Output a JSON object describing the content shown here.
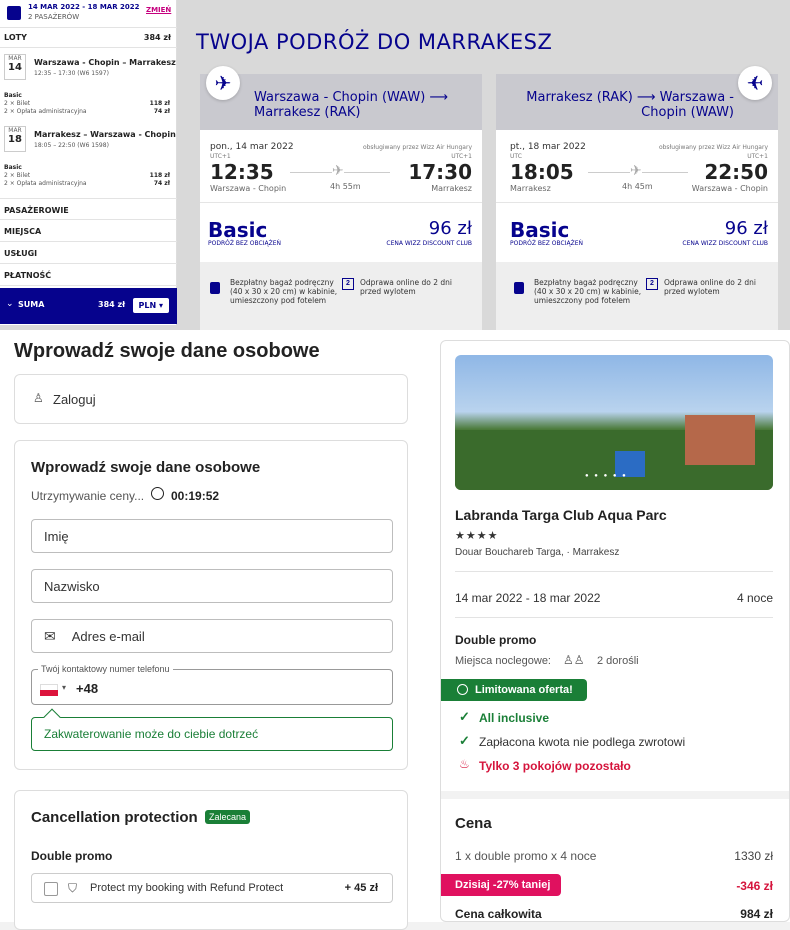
{
  "summary": {
    "dates": "14 MAR 2022 - 18 MAR 2022",
    "passengers": "2 PASAŻERÓW",
    "change": "ZMIEŃ",
    "flights_label": "LOTY",
    "flights_total": "384 zł",
    "flight1": {
      "month": "MAR",
      "day": "14",
      "route": "Warszawa - Chopin – Marrakesz",
      "time": "12:35 – 17:30 (W6 1597)",
      "fare": "Basic",
      "line1": "2 × Bilet",
      "line1_price": "118 zł",
      "line2": "2 × Opłata administracyjna",
      "line2_price": "74 zł"
    },
    "flight2": {
      "month": "MAR",
      "day": "18",
      "route": "Marrakesz – Warszawa - Chopin",
      "time": "18:05 – 22:50 (W6 1598)",
      "fare": "Basic",
      "line1": "2 × Bilet",
      "line1_price": "118 zł",
      "line2": "2 × Opłata administracyjna",
      "line2_price": "74 zł"
    },
    "sections": [
      "PASAŻEROWIE",
      "MIEJSCA",
      "USŁUGI",
      "PŁATNOŚĆ"
    ],
    "suma_label": "SUMA",
    "suma_value": "384 zł",
    "currency": "PLN"
  },
  "trip_title": "TWOJA PODRÓŻ DO MARRAKESZ",
  "outbound": {
    "title": "Warszawa - Chopin (WAW) ⟶ Marrakesz (RAK)",
    "date": "pon., 14 mar 2022",
    "operated": "obsługiwany przez Wizz Air Hungary",
    "utc_dep": "UTC+1",
    "utc_arr": "UTC+1",
    "dep_time": "12:35",
    "arr_time": "17:30",
    "duration": "4h 55m",
    "dep_city": "Warszawa - Chopin",
    "arr_city": "Marrakesz",
    "fare": "Basic",
    "fare_sub": "PODRÓŻ BEZ OBCIĄŻEŃ",
    "price": "96 zł",
    "price_sub": "CENA WIZZ DISCOUNT CLUB",
    "bag": "Bezpłatny bagaż podręczny (40 x 30 x 20 cm) w kabinie, umieszczony pod fotelem",
    "checkin_num": "2",
    "checkin": "Odprawa online do 2 dni przed wylotem"
  },
  "inbound": {
    "title": "Marrakesz (RAK) ⟶ Warszawa - Chopin (WAW)",
    "date": "pt., 18 mar 2022",
    "operated": "obsługiwany przez Wizz Air Hungary",
    "utc_dep": "UTC",
    "utc_arr": "UTC+1",
    "dep_time": "18:05",
    "arr_time": "22:50",
    "duration": "4h 45m",
    "dep_city": "Marrakesz",
    "arr_city": "Warszawa - Chopin",
    "fare": "Basic",
    "fare_sub": "PODRÓŻ BEZ OBCIĄŻEŃ",
    "price": "96 zł",
    "price_sub": "CENA WIZZ DISCOUNT CLUB",
    "bag": "Bezpłatny bagaż podręczny (40 x 30 x 20 cm) w kabinie, umieszczony pod fotelem",
    "checkin_num": "2",
    "checkin": "Odprawa online do 2 dni przed wylotem"
  },
  "form": {
    "heading": "Wprowadź swoje dane osobowe",
    "login": "Zaloguj",
    "subheading": "Wprowadź swoje dane osobowe",
    "hold_label": "Utrzymywanie ceny...",
    "timer": "00:19:52",
    "first_name_placeholder": "Imię",
    "last_name_placeholder": "Nazwisko",
    "email_placeholder": "Adres e-mail",
    "phone_label": "Twój kontaktowy numer telefonu",
    "phone_prefix": "+48",
    "tooltip": "Zakwaterowanie może do ciebie dotrzeć",
    "cancel_title": "Cancellation protection",
    "cancel_badge": "Zalecana",
    "cancel_sub": "Double promo",
    "protect_label": "Protect my booking with Refund Protect",
    "protect_price": "+ 45 zł"
  },
  "hotel": {
    "name": "Labranda Targa Club Aqua Parc",
    "stars": "★★★★",
    "address": "Douar Bouchareb Targa, · Marrakesz",
    "dates": "14 mar 2022 - 18 mar 2022",
    "nights": "4 noce",
    "room": "Double promo",
    "beds_label": "Miejsca noclegowe:",
    "guests": "2 dorośli",
    "limited": "Limitowana oferta!",
    "all_inclusive": "All inclusive",
    "nonrefund": "Zapłacona kwota nie podlega zwrotowi",
    "rooms_left": "Tylko 3 pokojów pozostało",
    "price_title": "Cena",
    "line1": "1 x double promo x 4 noce",
    "line1_price": "1330 zł",
    "discount": "Dzisiaj -27% taniej",
    "discount_price": "-346 zł",
    "total_label": "Cena całkowita",
    "total_price": "984 zł"
  },
  "colors": {
    "wizz_blue": "#06038d",
    "wizz_magenta": "#c6007e",
    "green": "#1a7f37",
    "red": "#d5143c"
  }
}
